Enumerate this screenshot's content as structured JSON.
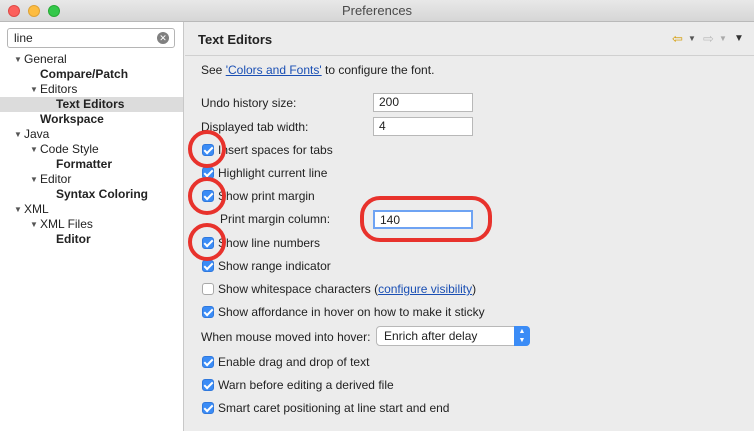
{
  "window": {
    "title": "Preferences"
  },
  "sidebar": {
    "filter_value": "line",
    "tree": [
      {
        "label": "General",
        "twisty": "▼",
        "bold": false
      },
      {
        "label": "Compare/Patch",
        "twisty": "",
        "bold": true
      },
      {
        "label": "Editors",
        "twisty": "▼",
        "bold": false
      },
      {
        "label": "Text Editors",
        "twisty": "",
        "bold": true,
        "selected": true
      },
      {
        "label": "Workspace",
        "twisty": "",
        "bold": true
      },
      {
        "label": "Java",
        "twisty": "▼",
        "bold": false
      },
      {
        "label": "Code Style",
        "twisty": "▼",
        "bold": false
      },
      {
        "label": "Formatter",
        "twisty": "",
        "bold": true
      },
      {
        "label": "Editor",
        "twisty": "▼",
        "bold": false
      },
      {
        "label": "Syntax Coloring",
        "twisty": "",
        "bold": true
      },
      {
        "label": "XML",
        "twisty": "▼",
        "bold": false
      },
      {
        "label": "XML Files",
        "twisty": "▼",
        "bold": false
      },
      {
        "label": "Editor",
        "twisty": "",
        "bold": true
      }
    ]
  },
  "page": {
    "title": "Text Editors",
    "nav_icons": {
      "back": "back-arrow-icon",
      "forward": "forward-arrow-icon",
      "menu": "view-menu-icon"
    },
    "see_prefix": "See ",
    "see_link": "'Colors and Fonts'",
    "see_suffix": " to configure the font.",
    "undo_label": "Undo history size:",
    "undo_value": "200",
    "tab_width_label": "Displayed tab width:",
    "tab_width_value": "4",
    "print_margin_label": "Print margin column:",
    "print_margin_value": "140",
    "hover_label": "When mouse moved into hover:",
    "hover_value": "Enrich after delay",
    "options": {
      "insert_spaces": {
        "label": "Insert spaces for tabs",
        "checked": true
      },
      "highlight_line": {
        "label": "Highlight current line",
        "checked": true
      },
      "show_print_margin": {
        "label": "Show print margin",
        "checked": true
      },
      "show_line_numbers": {
        "label": "Show line numbers",
        "checked": true
      },
      "show_range": {
        "label": "Show range indicator",
        "checked": true
      },
      "show_whitespace": {
        "label": "Show whitespace characters (",
        "link": "configure visibility",
        "suffix": ")",
        "checked": false
      },
      "show_affordance": {
        "label": "Show affordance in hover on how to make it sticky",
        "checked": true
      },
      "drag_drop": {
        "label": "Enable drag and drop of text",
        "checked": true
      },
      "warn_derived": {
        "label": "Warn before editing a derived file",
        "checked": true
      },
      "smart_caret": {
        "label": "Smart caret positioning at line start and end",
        "checked": true
      }
    }
  },
  "colors": {
    "accent": "#3b8cf6",
    "annotation": "#e8322c",
    "link": "#1a4fb4"
  }
}
